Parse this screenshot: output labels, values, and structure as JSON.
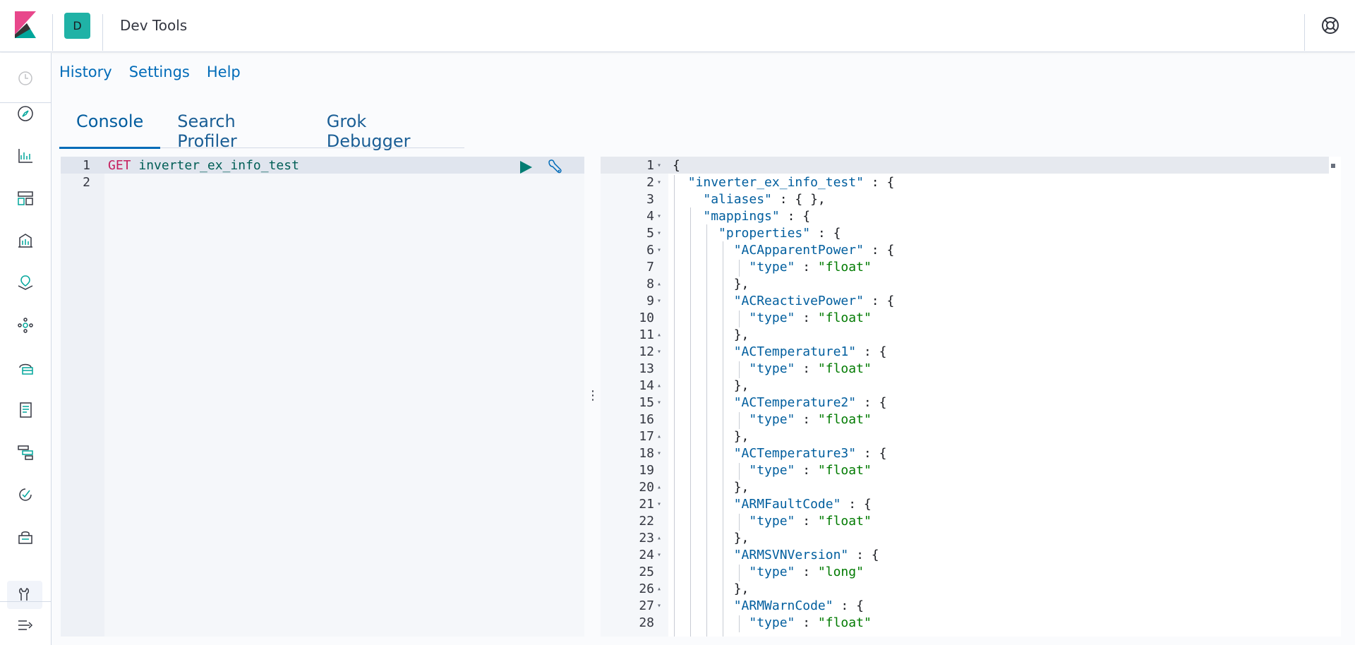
{
  "header": {
    "title": "Dev Tools",
    "space_initial": "D"
  },
  "sidebar": {
    "icons": [
      "clock-icon",
      "compass-icon",
      "visualize-icon",
      "dashboard-icon",
      "canvas-icon",
      "maps-icon",
      "ml-icon",
      "infrastructure-icon",
      "logs-icon",
      "apm-icon",
      "uptime-icon",
      "siem-icon",
      "devtools-icon",
      "collapse-icon"
    ]
  },
  "nav": {
    "history": "History",
    "settings": "Settings",
    "help": "Help"
  },
  "tabs": {
    "console": "Console",
    "profiler": "Search Profiler",
    "grok": "Grok Debugger"
  },
  "request": {
    "line1_method": "GET",
    "line1_path": " inverter_ex_info_test",
    "ln1": "1",
    "ln2": "2"
  },
  "response": {
    "lines": [
      "{",
      "  \"inverter_ex_info_test\" : {",
      "    \"aliases\" : { },",
      "    \"mappings\" : {",
      "      \"properties\" : {",
      "        \"ACApparentPower\" : {",
      "          \"type\" : \"float\"",
      "        },",
      "        \"ACReactivePower\" : {",
      "          \"type\" : \"float\"",
      "        },",
      "        \"ACTemperature1\" : {",
      "          \"type\" : \"float\"",
      "        },",
      "        \"ACTemperature2\" : {",
      "          \"type\" : \"float\"",
      "        },",
      "        \"ACTemperature3\" : {",
      "          \"type\" : \"float\"",
      "        },",
      "        \"ARMFaultCode\" : {",
      "          \"type\" : \"float\"",
      "        },",
      "        \"ARMSVNVersion\" : {",
      "          \"type\" : \"long\"",
      "        },",
      "        \"ARMWarnCode\" : {",
      "          \"type\" : \"float\""
    ],
    "folds": [
      "down",
      "down",
      "",
      "down",
      "down",
      "down",
      "",
      "up",
      "down",
      "",
      "up",
      "down",
      "",
      "up",
      "down",
      "",
      "up",
      "down",
      "",
      "up",
      "down",
      "",
      "up",
      "down",
      "",
      "up",
      "down",
      ""
    ]
  }
}
